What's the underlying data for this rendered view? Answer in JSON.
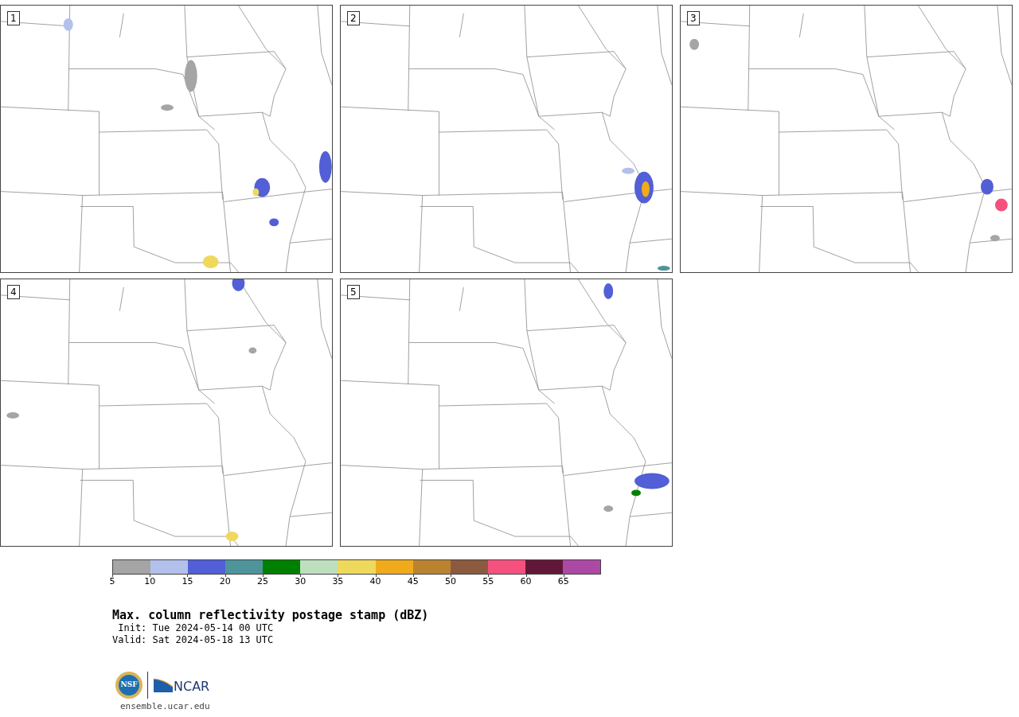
{
  "panels": [
    {
      "label": "1"
    },
    {
      "label": "2"
    },
    {
      "label": "3"
    },
    {
      "label": "4"
    },
    {
      "label": "5"
    }
  ],
  "colorbar": {
    "segments": [
      {
        "color": "#a5a5a5"
      },
      {
        "color": "#b4c0ec"
      },
      {
        "color": "#525fd6"
      },
      {
        "color": "#4e949b"
      },
      {
        "color": "#008000"
      },
      {
        "color": "#bedfbd"
      },
      {
        "color": "#efd95d"
      },
      {
        "color": "#f0ab1c"
      },
      {
        "color": "#b98330"
      },
      {
        "color": "#8b5a3f"
      },
      {
        "color": "#f5517f"
      },
      {
        "color": "#611838"
      },
      {
        "color": "#ac49a5"
      }
    ],
    "ticks": [
      "5",
      "10",
      "15",
      "20",
      "25",
      "30",
      "35",
      "40",
      "45",
      "50",
      "55",
      "60",
      "65"
    ]
  },
  "title": "Max. column reflectivity postage stamp (dBZ)",
  "init": " Init: Tue 2024-05-14 00 UTC",
  "valid": "Valid: Sat 2024-05-18 13 UTC",
  "logo": {
    "left": "NSF",
    "right": "NCAR"
  },
  "url": "ensemble.ucar.edu"
}
